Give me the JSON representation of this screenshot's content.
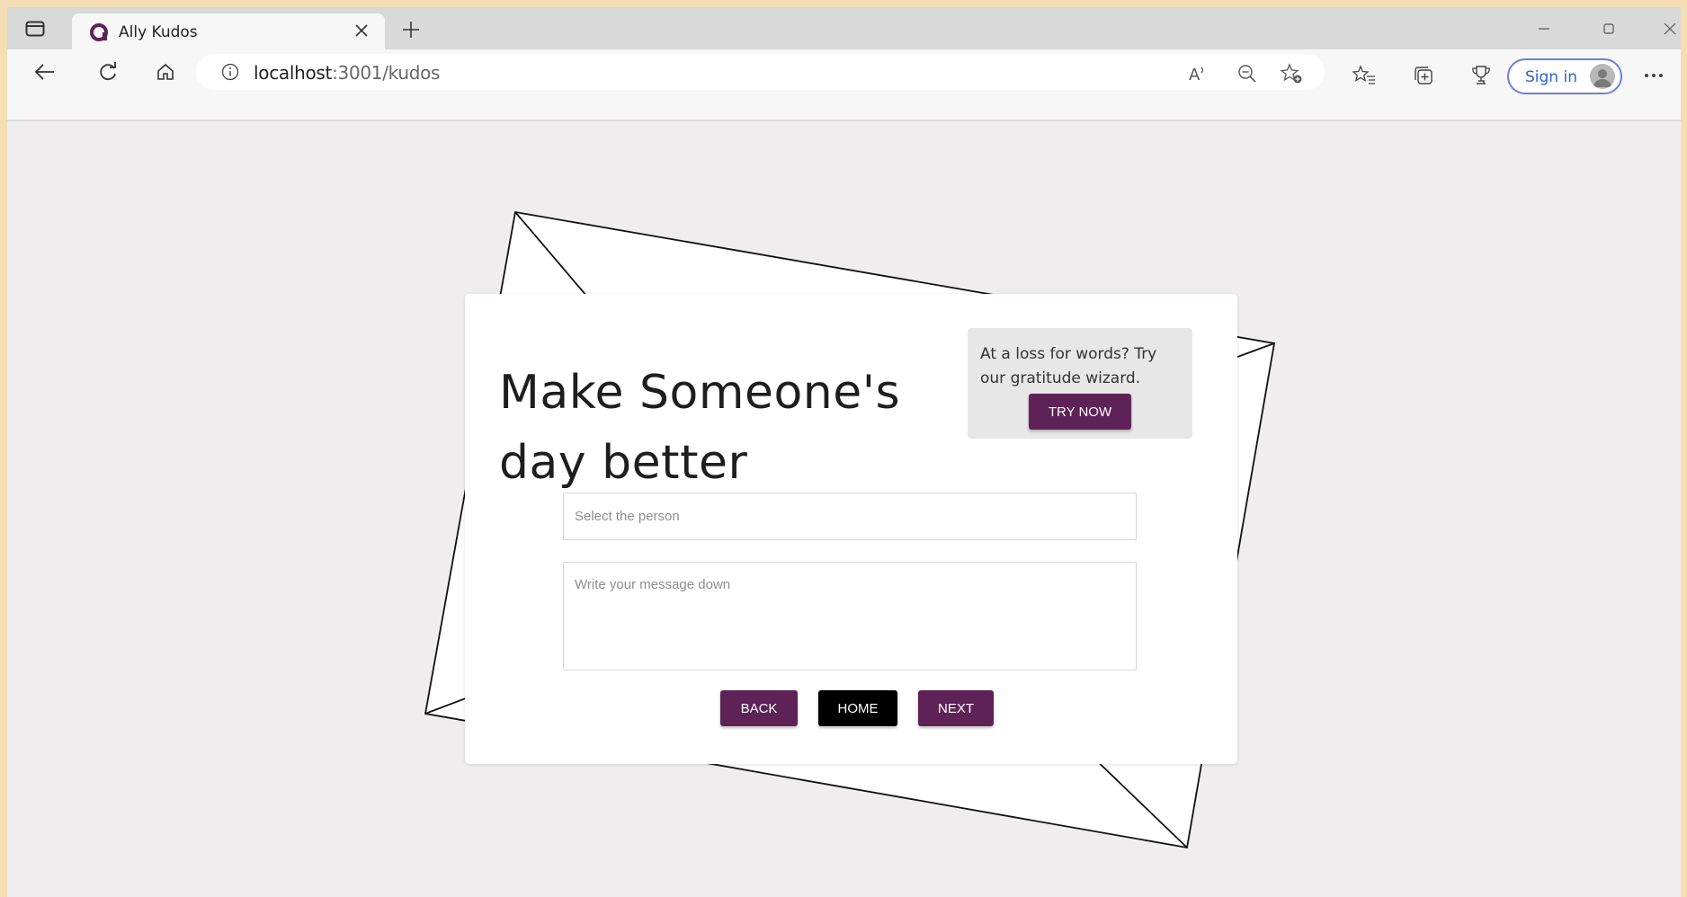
{
  "browser": {
    "tab": {
      "title": "Ally Kudos",
      "favicon": "ally-logo-icon"
    },
    "address_bar": {
      "host": "localhost",
      "path": ":3001/kudos"
    },
    "sign_in_label": "Sign in",
    "icons": {
      "tab_actions": "tab-actions-icon",
      "close_tab": "close-icon",
      "new_tab": "plus-icon",
      "back": "arrow-left-icon",
      "refresh": "refresh-icon",
      "home": "home-icon",
      "info": "info-icon",
      "read_aloud": "read-aloud-icon",
      "zoom": "zoom-out-icon",
      "add_favorite": "add-favorite-icon",
      "favorites": "favorites-icon",
      "collections": "collections-icon",
      "extensions": "trophy-icon",
      "more": "more-icon"
    }
  },
  "page": {
    "headline": "Make Someone's day better",
    "wizard": {
      "text": "At a loss for words? Try our gratitude wizard.",
      "button_label": "TRY NOW"
    },
    "form": {
      "person_placeholder": "Select the person",
      "message_placeholder": "Write your message down"
    },
    "buttons": {
      "back": "BACK",
      "home": "HOME",
      "next": "NEXT"
    }
  },
  "colors": {
    "brand_purple": "#5e2257",
    "page_background": "#efeded",
    "card_background": "#ffffff",
    "outer_frame": "#f5deb3"
  }
}
